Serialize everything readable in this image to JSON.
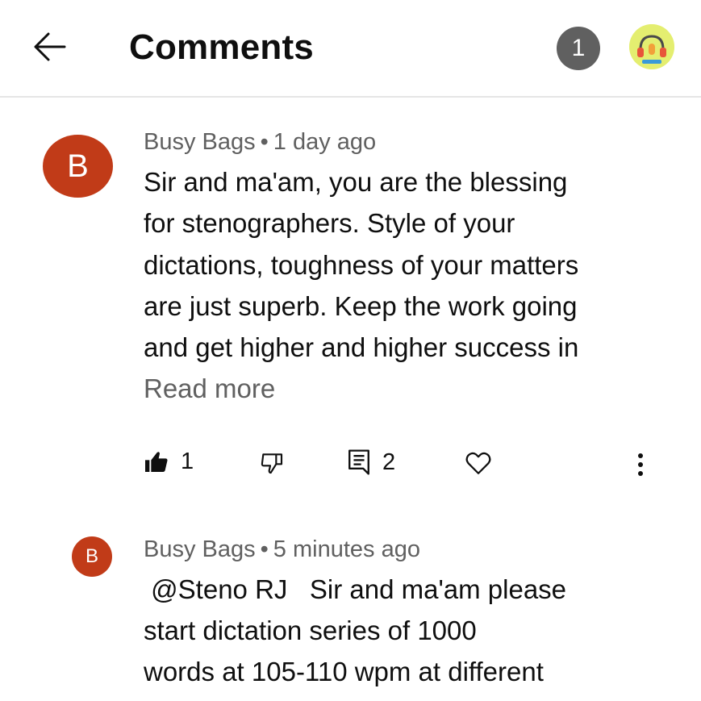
{
  "header": {
    "title": "Comments",
    "badge_count": "1",
    "icons": {
      "back": "arrow-left-icon"
    }
  },
  "comments": [
    {
      "avatar_letter": "B",
      "author": "Busy Bags",
      "separator": "•",
      "time": "1 day ago",
      "lines": [
        "Sir and ma'am, you are the blessing",
        "for stenographers. Style of your",
        "dictations, toughness of your matters",
        "are just superb. Keep the work going",
        "and get higher and higher success in"
      ],
      "read_more": "Read more",
      "likes": "1",
      "replies": "2"
    },
    {
      "avatar_letter": "B",
      "author": "Busy Bags",
      "separator": "•",
      "time": "5 minutes ago",
      "lines": [
        " @Steno RJ   Sir and ma'am please",
        "start dictation series of 1000",
        "words at 105-110 wpm at different"
      ]
    }
  ],
  "colors": {
    "avatar_bg": "#c13b18",
    "badge_bg": "#606060",
    "secondary_text": "#606060"
  }
}
